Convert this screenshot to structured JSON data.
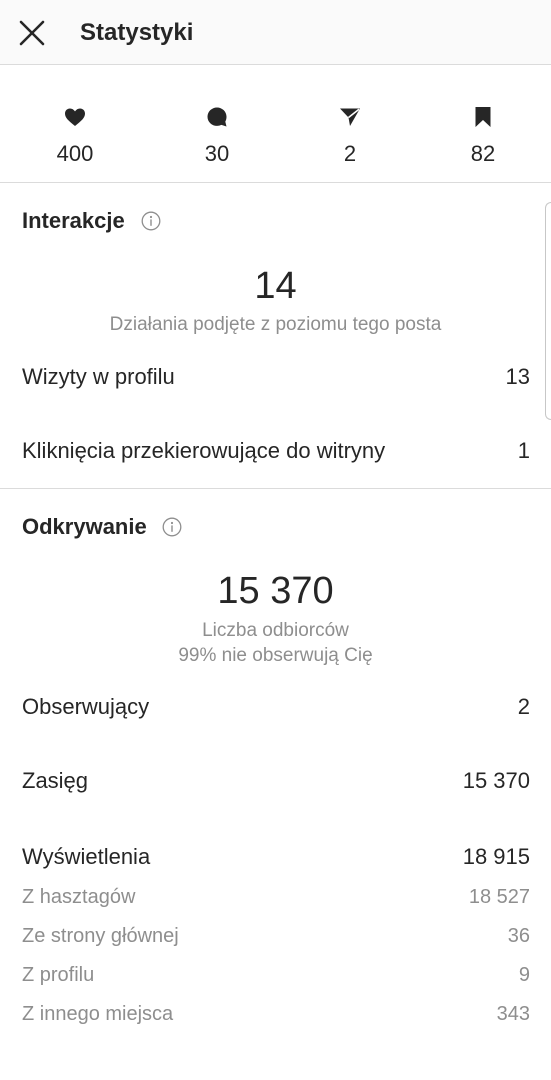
{
  "header": {
    "title": "Statystyki"
  },
  "stats": [
    {
      "icon": "heart-icon",
      "value": "400"
    },
    {
      "icon": "comment-icon",
      "value": "30"
    },
    {
      "icon": "send-icon",
      "value": "2"
    },
    {
      "icon": "bookmark-icon",
      "value": "82"
    }
  ],
  "interactions": {
    "title": "Interakcje",
    "total": "14",
    "caption": "Działania podjęte z poziomu tego posta",
    "rows": [
      {
        "label": "Wizyty w profilu",
        "value": "13"
      },
      {
        "label": "Kliknięcia przekierowujące do witryny",
        "value": "1"
      }
    ]
  },
  "discovery": {
    "title": "Odkrywanie",
    "total": "15 370",
    "caption1": "Liczba odbiorców",
    "caption2": "99% nie obserwują Cię",
    "rows": [
      {
        "label": "Obserwujący",
        "value": "2"
      },
      {
        "label": "Zasięg",
        "value": "15 370"
      },
      {
        "label": "Wyświetlenia",
        "value": "18 915"
      }
    ],
    "subrows": [
      {
        "label": "Z hasztagów",
        "value": "18 527"
      },
      {
        "label": "Ze strony głównej",
        "value": "36"
      },
      {
        "label": "Z profilu",
        "value": "9"
      },
      {
        "label": "Z innego miejsca",
        "value": "343"
      }
    ]
  },
  "colors": {
    "text": "#262626",
    "secondary": "#8e8e8e",
    "divider": "#dbdbdb",
    "header_bg": "#fafafa"
  }
}
